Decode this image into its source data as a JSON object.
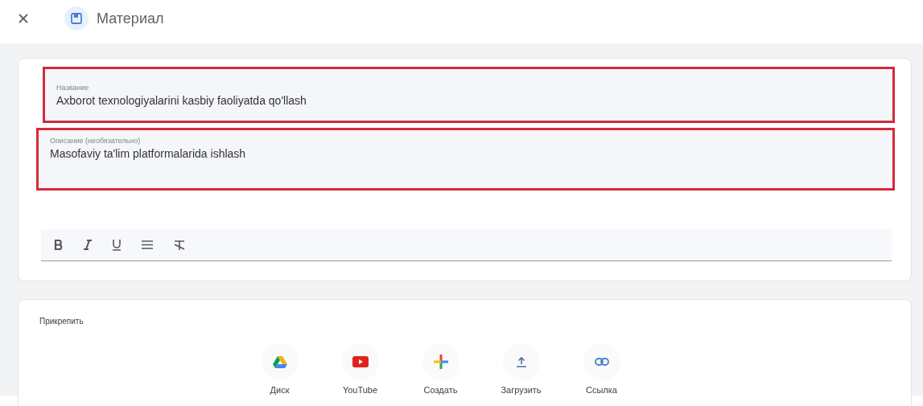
{
  "header": {
    "title": "Материал"
  },
  "fields": [
    {
      "label": "Название",
      "value": "Axborot texnologiyalarini kasbiy faoliyatda qo'llash"
    },
    {
      "label": "Описание (необязательно)",
      "value": "Masofaviy ta'lim platformalarida ishlash"
    }
  ],
  "format_tools": [
    {
      "kind": "bold"
    },
    {
      "kind": "italic"
    },
    {
      "kind": "underline"
    },
    {
      "kind": "list"
    },
    {
      "kind": "clear"
    }
  ],
  "attach": {
    "title": "Прикрепить",
    "items": [
      {
        "kind": "drive",
        "label": "Диск"
      },
      {
        "kind": "youtube",
        "label": "YouTube"
      },
      {
        "kind": "create",
        "label": "Создать"
      },
      {
        "kind": "upload",
        "label": "Загрузить"
      },
      {
        "kind": "link",
        "label": "Ссылка"
      }
    ]
  }
}
